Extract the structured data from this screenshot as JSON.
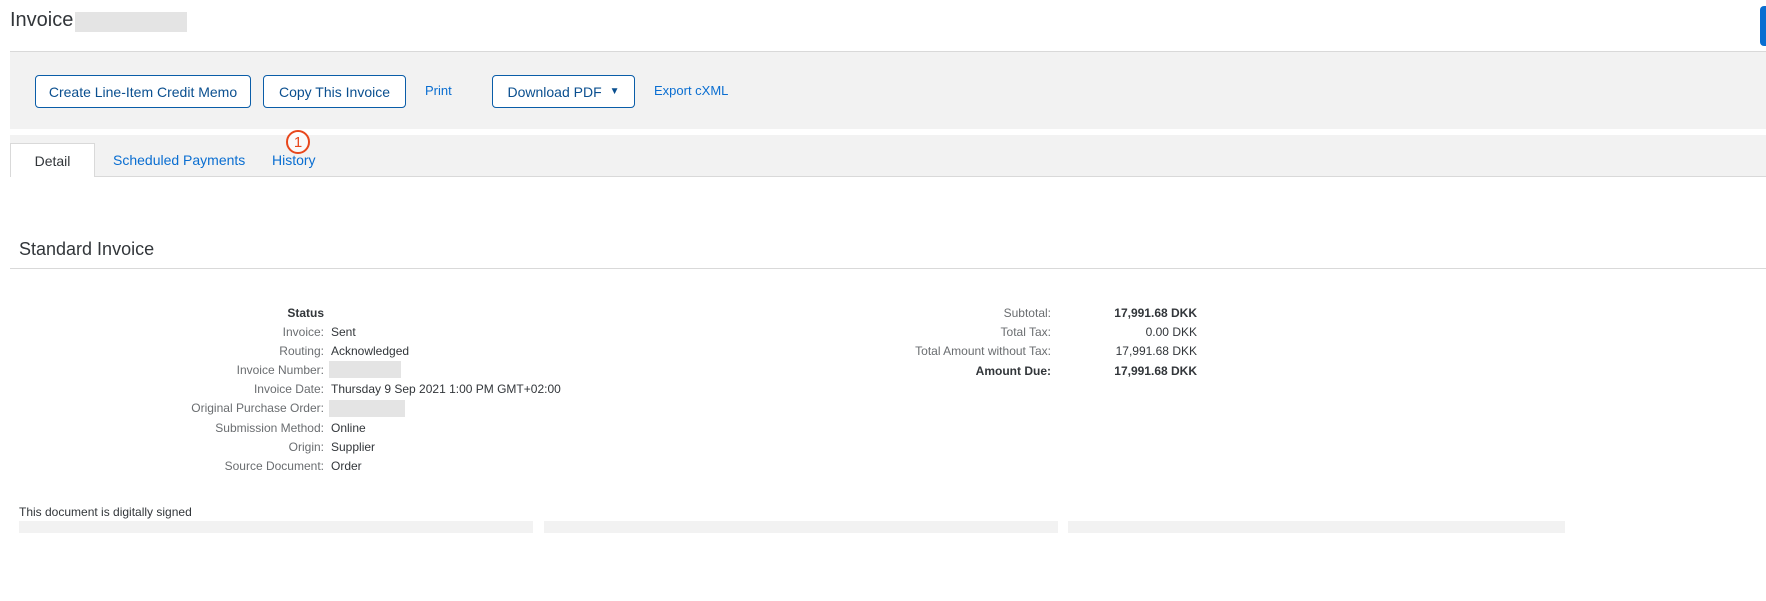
{
  "header": {
    "title": "Invoice:"
  },
  "toolbar": {
    "credit_memo": "Create Line-Item Credit Memo",
    "copy": "Copy This Invoice",
    "print": "Print",
    "download": "Download PDF",
    "download_arrow": "▼",
    "export": "Export cXML"
  },
  "tabs": [
    {
      "label": "Detail"
    },
    {
      "label": "Scheduled Payments"
    },
    {
      "label": "History"
    }
  ],
  "annotation": "1",
  "section_title": "Standard Invoice",
  "status": {
    "heading": "Status",
    "rows": [
      {
        "label": "Invoice:",
        "value": "Sent"
      },
      {
        "label": "Routing:",
        "value": "Acknowledged"
      },
      {
        "label": "Invoice Number:",
        "value": ""
      },
      {
        "label": "Invoice Date:",
        "value": "Thursday 9 Sep 2021 1:00 PM GMT+02:00"
      },
      {
        "label": "Original Purchase Order:",
        "value": ""
      },
      {
        "label": "Submission Method:",
        "value": "Online"
      },
      {
        "label": "Origin:",
        "value": "Supplier"
      },
      {
        "label": "Source Document:",
        "value": "Order"
      }
    ]
  },
  "totals": [
    {
      "label": "Subtotal:",
      "value": "17,991.68 DKK"
    },
    {
      "label": "Total Tax:",
      "value": "0.00 DKK"
    },
    {
      "label": "Total Amount without Tax:",
      "value": "17,991.68 DKK"
    },
    {
      "label": "Amount Due:",
      "value": "17,991.68 DKK"
    }
  ],
  "signed_note": "This document is digitally signed"
}
